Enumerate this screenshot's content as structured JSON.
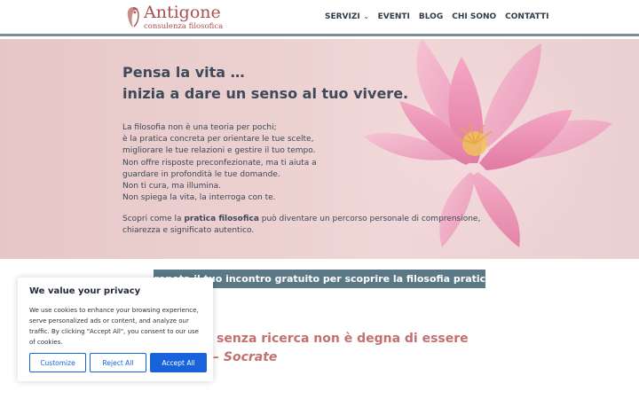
{
  "logo": {
    "title": "Antigone",
    "subtitle": "consulenza filosofica"
  },
  "nav": [
    {
      "label": "SERVIZI",
      "has_dropdown": true
    },
    {
      "label": "EVENTI"
    },
    {
      "label": "BLOG"
    },
    {
      "label": "CHI SONO"
    },
    {
      "label": "CONTATTI"
    }
  ],
  "hero": {
    "heading_line1": "Pensa la vita …",
    "heading_line2": "inizia a dare un senso al tuo vivere.",
    "body_lines": [
      "La filosofia non è una teoria per pochi;",
      "è la pratica concreta per orientare le tue scelte,",
      "migliorare le tue relazioni e gestire il tuo tempo.",
      "Non offre risposte preconfezionate, ma ti aiuta a",
      "guardare in profondità le tue domande.",
      "Non ti cura, ma illumina.",
      "Non spiega la vita, la interroga con te."
    ],
    "cta_prefix": "Scopri come la ",
    "cta_bold": "pratica filosofica",
    "cta_suffix": " può diventare un percorso personale di comprensione, chiarezza e significato autentico."
  },
  "booking_button": "Prenota il tuo incontro gratuito per scoprire la filosofia pratica",
  "quote": {
    "line1": "senza ricerca non è degna di essere",
    "line2": "– Socrate"
  },
  "cookie": {
    "title": "We value your privacy",
    "text": "We use cookies to enhance your browsing experience, serve personalized ads or content, and analyze our traffic. By clicking \"Accept All\", you consent to our use of cookies.",
    "customize": "Customize",
    "reject": "Reject All",
    "accept": "Accept All"
  },
  "colors": {
    "brand": "#a84f4f",
    "header_border": "#7c8d96",
    "booking_bg": "#5a7886",
    "quote": "#c47070",
    "cookie_accent": "#1863dc"
  }
}
